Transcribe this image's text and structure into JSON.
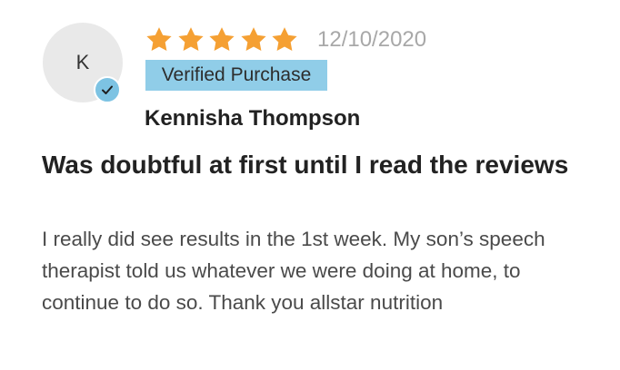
{
  "review": {
    "avatar_initial": "K",
    "rating": 5,
    "date": "12/10/2020",
    "verified_label": "Verified Purchase",
    "reviewer_name": "Kennisha Thompson",
    "title": "Was doubtful at first until I read the reviews",
    "body": "I really did see results in the 1st week. My son’s speech therapist told us whatever we were doing at home, to continue to do so. Thank you allstar nutrition"
  },
  "icons": {
    "star": "star-icon",
    "verified": "checkmark-icon"
  },
  "colors": {
    "star": "#f5a033",
    "verified_badge": "#90cde8",
    "avatar_badge": "#7dc3e3",
    "avatar_bg": "#e9e9e9",
    "date": "#a8a8a8",
    "text": "#222222",
    "body_text": "#4a4a4a"
  }
}
